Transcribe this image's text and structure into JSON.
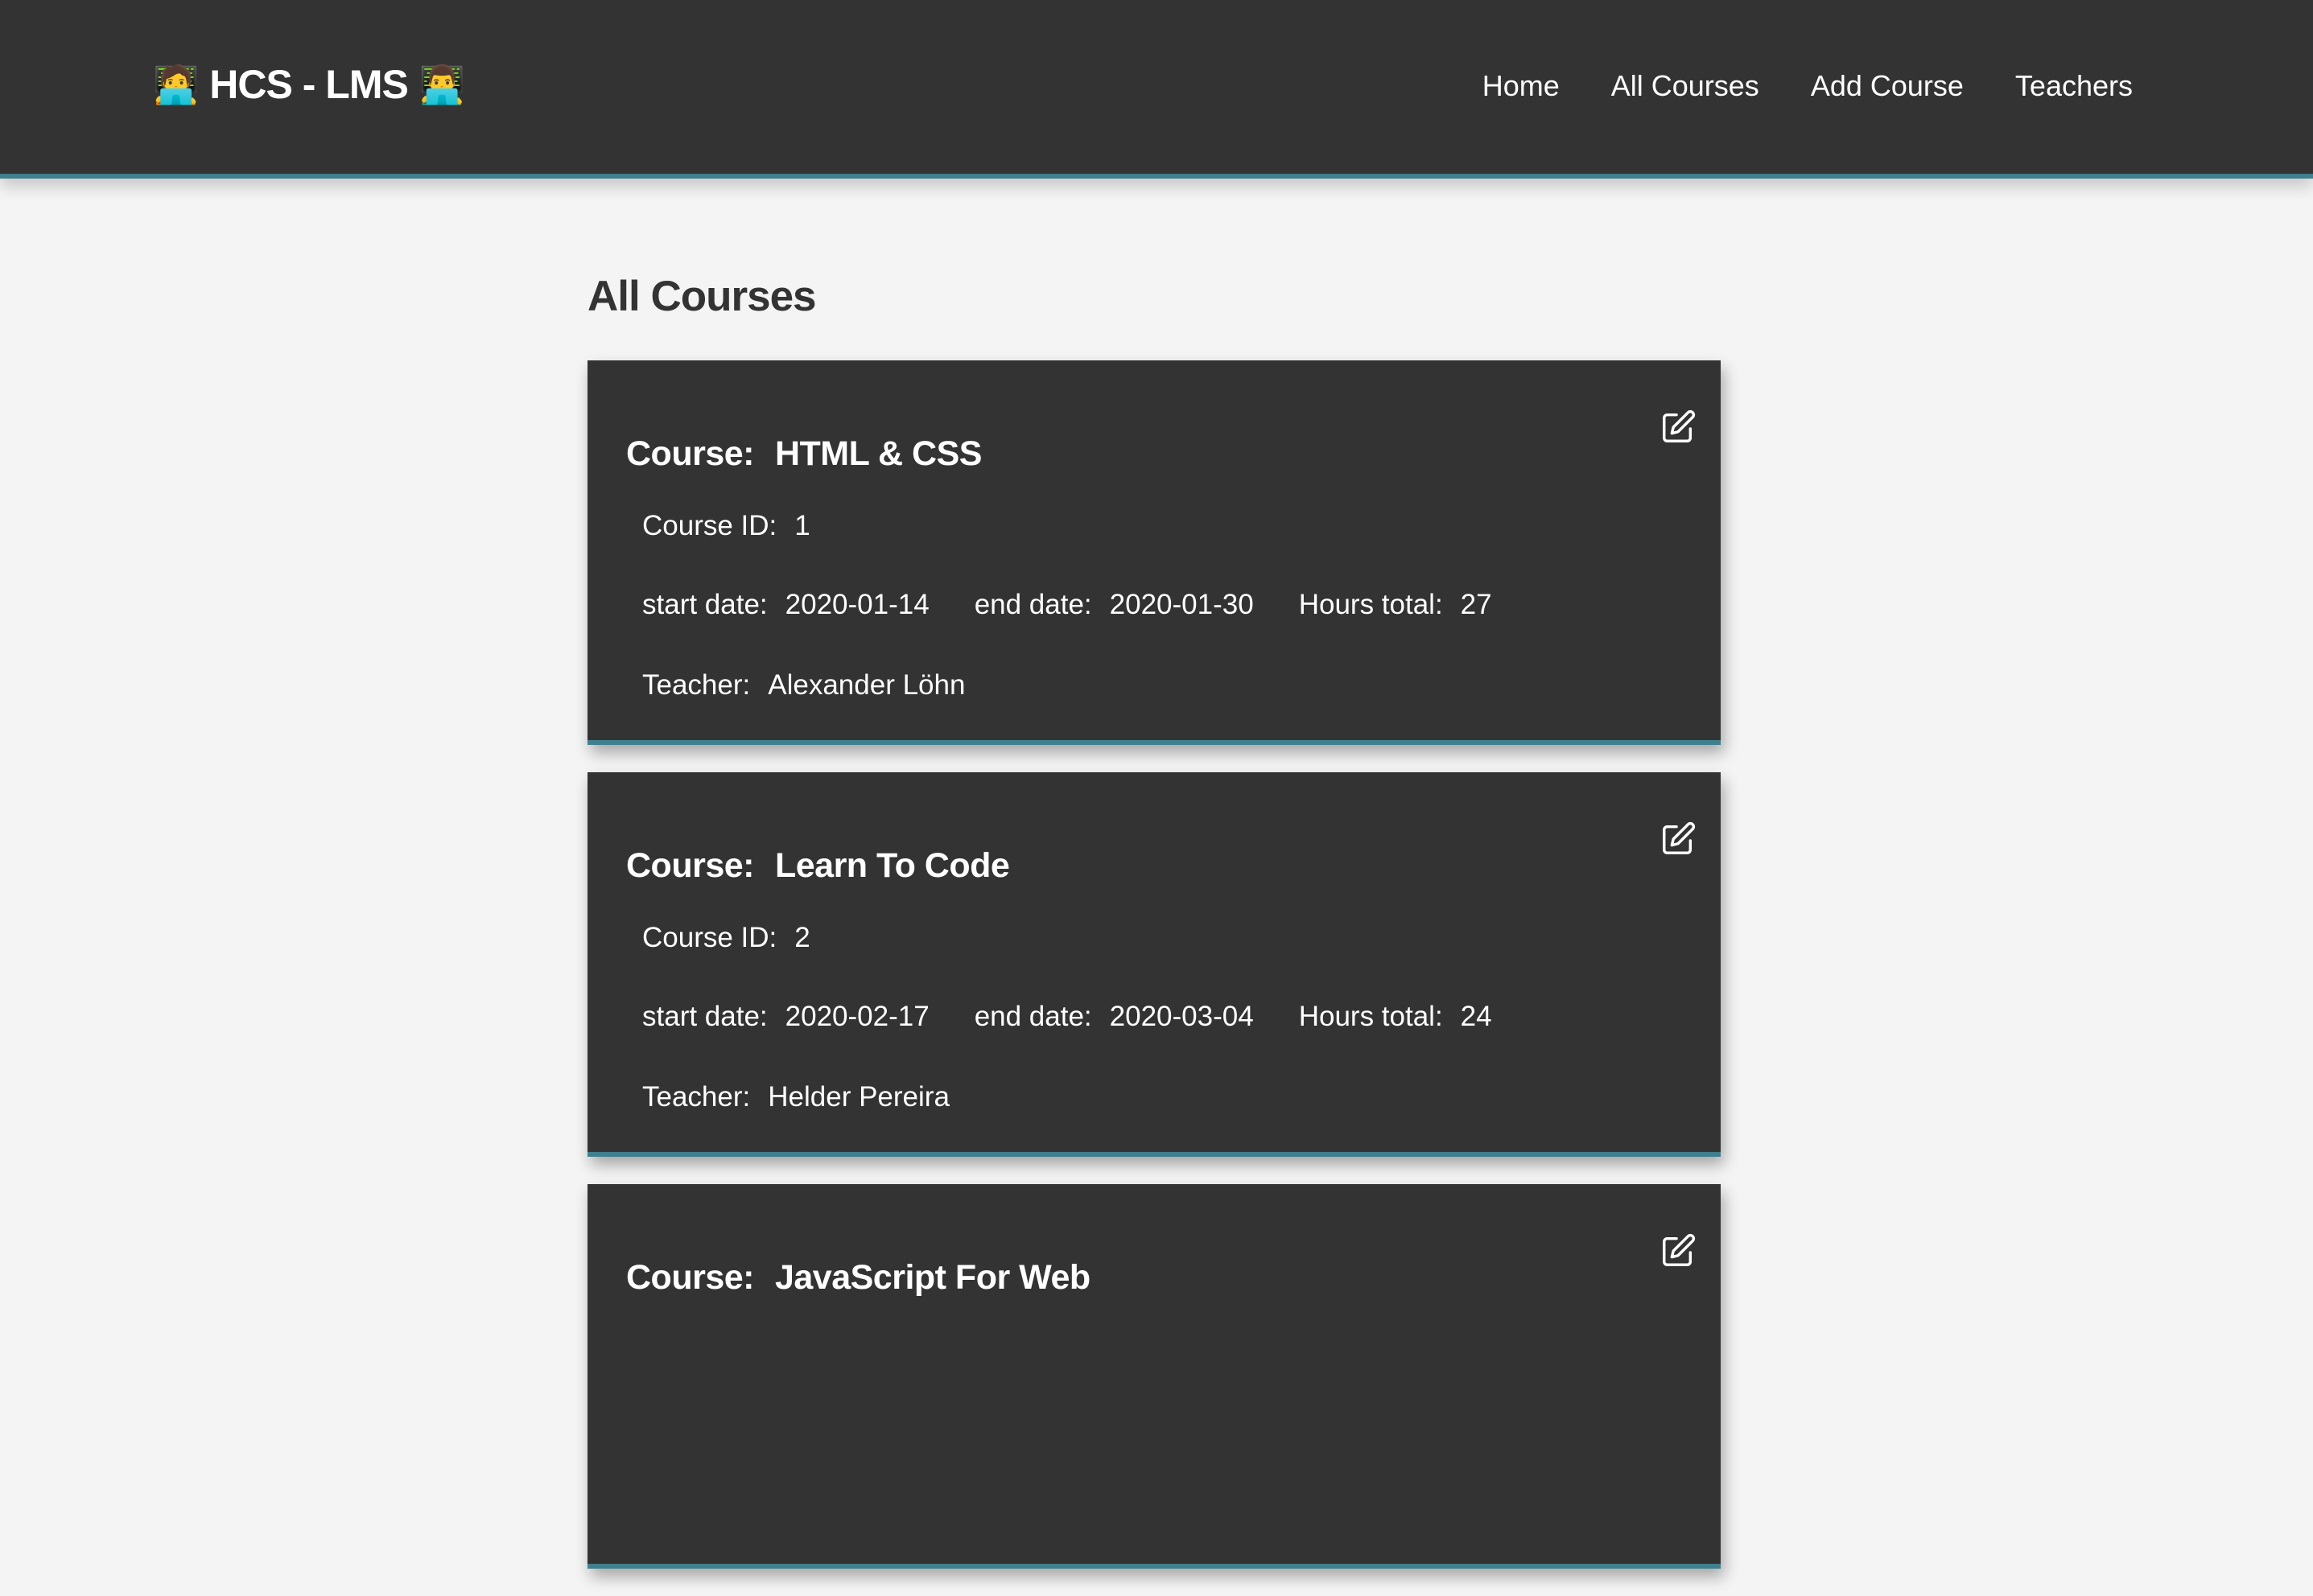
{
  "brand": {
    "left_emoji": "🧑‍💻",
    "title": "HCS - LMS",
    "right_emoji": "👨‍💻"
  },
  "nav": {
    "links": [
      "Home",
      "All Courses",
      "Add Course",
      "Teachers"
    ]
  },
  "page": {
    "title": "All Courses"
  },
  "labels": {
    "course": "Course:",
    "course_id": "Course ID:",
    "start_date": "start date:",
    "end_date": "end date:",
    "hours_total": "Hours total:",
    "teacher": "Teacher:"
  },
  "courses": [
    {
      "name": "HTML & CSS",
      "id": "1",
      "start_date": "2020-01-14",
      "end_date": "2020-01-30",
      "hours_total": "27",
      "teacher": "Alexander Löhn"
    },
    {
      "name": "Learn To Code",
      "id": "2",
      "start_date": "2020-02-17",
      "end_date": "2020-03-04",
      "hours_total": "24",
      "teacher": "Helder Pereira"
    },
    {
      "name": "JavaScript For Web",
      "id": "",
      "start_date": "",
      "end_date": "",
      "hours_total": "",
      "teacher": ""
    }
  ],
  "colors": {
    "dark": "#333333",
    "accent": "#3f7f8e",
    "background": "#f4f4f4"
  },
  "icons": {
    "edit": "edit-icon"
  }
}
